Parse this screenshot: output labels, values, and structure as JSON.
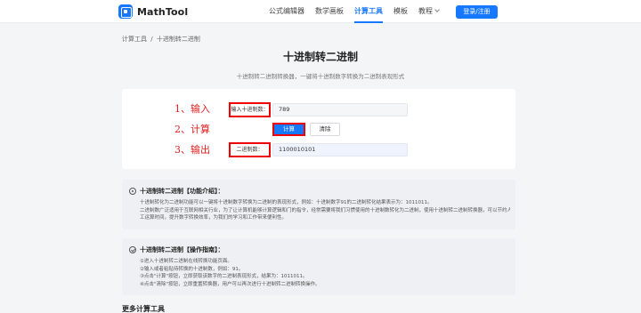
{
  "header": {
    "logo_text": "MathTool",
    "nav": [
      {
        "label": "公式编辑器",
        "active": false
      },
      {
        "label": "数学画板",
        "active": false
      },
      {
        "label": "计算工具",
        "active": true
      },
      {
        "label": "模板",
        "active": false
      },
      {
        "label": "教程",
        "active": false
      }
    ],
    "login_label": "登录/注册"
  },
  "breadcrumb": {
    "root": "计算工具",
    "sep": "/",
    "current": "十进制转二进制"
  },
  "page_title": "十进制转二进制",
  "subtitle": "十进制转二进制转换器，一键将十进制数字转换为二进制表现形式",
  "annotations": {
    "step1": "1、输入",
    "step2": "2、计算",
    "step3": "3、输出"
  },
  "tool": {
    "input_label": "输入十进制数：",
    "input_value": "789",
    "calc_label": "计算",
    "clear_label": "清除",
    "output_label": "二进制数：",
    "output_value": "1100010101"
  },
  "intro": {
    "title": "十进制转二进制【功能介绍】：",
    "lines": [
      "十进制转化为二进制功能可以一键将十进制数字转换为二进制的表现形式，例如：十进制数字91的二进制转化结果表示为：1011011。",
      "二进制数广泛适用于互联网相关行业，为了让计算机能够计算逻辑和门的指令，经常需要将我们习惯使用的十进制数转化为二进制，使用十进制转二进制转换器，可以节约人",
      "工运算时间，提升数字转换效率，为我们的学习和工作带来便利性。"
    ]
  },
  "guide": {
    "title": "十进制转二进制【操作指南】：",
    "lines": [
      "①进入十进制转二进制在线转换功能页面。",
      "②输入或者粘贴待转换的十进制数，例如：91。",
      "③点击\"计算\"按钮，立即获取该数字的二进制表现形式，结果为：1011011。",
      "④点击\"清除\"按钮，立即重置转换器，用户可以再次进行十进制转二进制转换操作。"
    ]
  },
  "more_title": "更多计算工具",
  "colors": {
    "accent": "#1677ff",
    "annotation": "#e02020"
  }
}
